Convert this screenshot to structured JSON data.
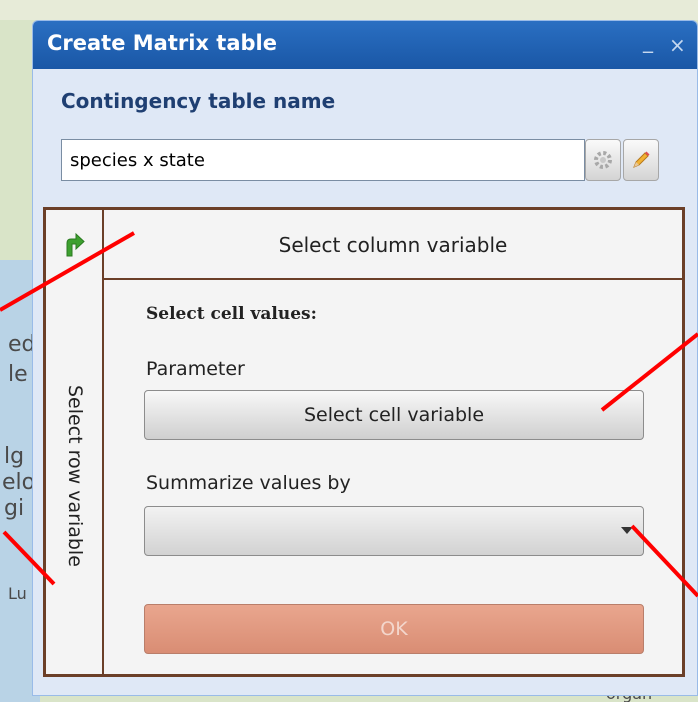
{
  "map": {
    "labels": [
      "ed",
      "le",
      "lg",
      "elo",
      "gi",
      "Lu",
      "organ"
    ]
  },
  "window": {
    "title": "Create Matrix table",
    "minimize_label": "_",
    "close_label": "×"
  },
  "form": {
    "name_label": "Contingency table name",
    "name_value": "species x state",
    "settings_icon": "gear-icon",
    "edit_icon": "pencil-icon"
  },
  "panel": {
    "corner_icon": "swap-arrow-icon",
    "column_variable_label": "Select column variable",
    "row_variable_label": "Select row variable",
    "cell_heading": "Select cell values:",
    "parameter_label": "Parameter",
    "cell_variable_button": "Select cell variable",
    "summarize_label": "Summarize values by",
    "summarize_value": "",
    "ok_button": "OK"
  },
  "colors": {
    "title_bar": "#1f62b4",
    "panel_border": "#6b3f28",
    "ok_button": "#e09a80",
    "annotation": "#ff0000"
  }
}
